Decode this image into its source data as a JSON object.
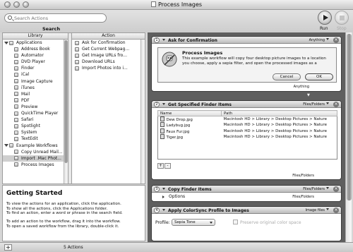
{
  "window": {
    "title": "Process Images"
  },
  "toolbar": {
    "search_placeholder": "Search Actions",
    "search_label": "Search",
    "run_label": "Run",
    "stop_label": "Stop"
  },
  "library": {
    "header": "Library",
    "items": [
      {
        "label": "Applications",
        "type": "folder-open",
        "indent": 0
      },
      {
        "label": "Address Book",
        "type": "app",
        "indent": 1
      },
      {
        "label": "Automator",
        "type": "app",
        "indent": 1
      },
      {
        "label": "DVD Player",
        "type": "app",
        "indent": 1
      },
      {
        "label": "Finder",
        "type": "app",
        "indent": 1
      },
      {
        "label": "iCal",
        "type": "app",
        "indent": 1
      },
      {
        "label": "Image Capture",
        "type": "app",
        "indent": 1
      },
      {
        "label": "iTunes",
        "type": "app",
        "indent": 1
      },
      {
        "label": "Mail",
        "type": "app",
        "indent": 1
      },
      {
        "label": "PDF",
        "type": "app",
        "indent": 1
      },
      {
        "label": "Preview",
        "type": "app",
        "indent": 1
      },
      {
        "label": "QuickTime Player",
        "type": "app",
        "indent": 1
      },
      {
        "label": "Safari",
        "type": "app",
        "indent": 1
      },
      {
        "label": "Spotlight",
        "type": "app",
        "indent": 1
      },
      {
        "label": "System",
        "type": "app",
        "indent": 1
      },
      {
        "label": "TextEdit",
        "type": "app",
        "indent": 1
      },
      {
        "label": "Example Workflows",
        "type": "folder-open",
        "indent": 0
      },
      {
        "label": "Copy Unread Mail...",
        "type": "app",
        "indent": 1
      },
      {
        "label": "Import .Mac Phot...",
        "type": "app",
        "indent": 1,
        "selected": true
      },
      {
        "label": "Process Images",
        "type": "app",
        "indent": 1
      }
    ]
  },
  "actions": {
    "header": "Action",
    "items": [
      "Ask for Confirmation",
      "Get Current Webpag...",
      "Get Image URLs fro...",
      "Download URLs",
      "Import Photos into i..."
    ]
  },
  "getting_started": {
    "title": "Getting Started",
    "lines": [
      "To view the actions for an application, click the application.",
      "To show all the actions, click the Applications folder.",
      "To find an action, enter a word or phrase in the search field.",
      "",
      "To add an action to the workflow, drag it into the workflow.",
      "To open a saved workflow from the library, double-click it."
    ]
  },
  "bottom": {
    "add_label": "+",
    "count": "5 Actions"
  },
  "workflow": {
    "actions": [
      {
        "number": "1",
        "name": "Ask for Confirmation",
        "type": "Anything",
        "expanded": true,
        "dialog_title": "Process Images",
        "dialog_text": "This example workflow will copy four desktop picture images to a location you choose, apply a sepia filter, and open the processed images as a",
        "cancel_label": "Cancel",
        "ok_label": "OK",
        "output": "Anything"
      },
      {
        "number": "2",
        "name": "Get Specified Finder Items",
        "type": "Files/Folders",
        "expanded": true,
        "columns": [
          "Name",
          "Path"
        ],
        "files": [
          {
            "name": "Dew Drop.jpg",
            "path": "Macintosh HD > Library > Desktop Pictures > Nature"
          },
          {
            "name": "Ladybug.jpg",
            "path": "Macintosh HD > Library > Desktop Pictures > Nature"
          },
          {
            "name": "Faux Fur.jpg",
            "path": "Macintosh HD > Library > Desktop Pictures > Nature"
          },
          {
            "name": "Tiger.jpg",
            "path": "Macintosh HD > Library > Desktop Pictures > Nature"
          }
        ],
        "add_label": "+",
        "remove_label": "-",
        "output": "Files/Folders"
      },
      {
        "number": "3",
        "name": "Copy Finder Items",
        "type": "Files/Folders",
        "expanded": false,
        "options_label": "Options",
        "output": "Files/Folders"
      },
      {
        "number": "4",
        "name": "Apply ColorSync Profile to Images",
        "type": "Image files",
        "expanded": true,
        "profile_label": "Profile:",
        "profile_value": "Sepia Tone",
        "preserve_label": "Preserve original color space"
      }
    ]
  }
}
